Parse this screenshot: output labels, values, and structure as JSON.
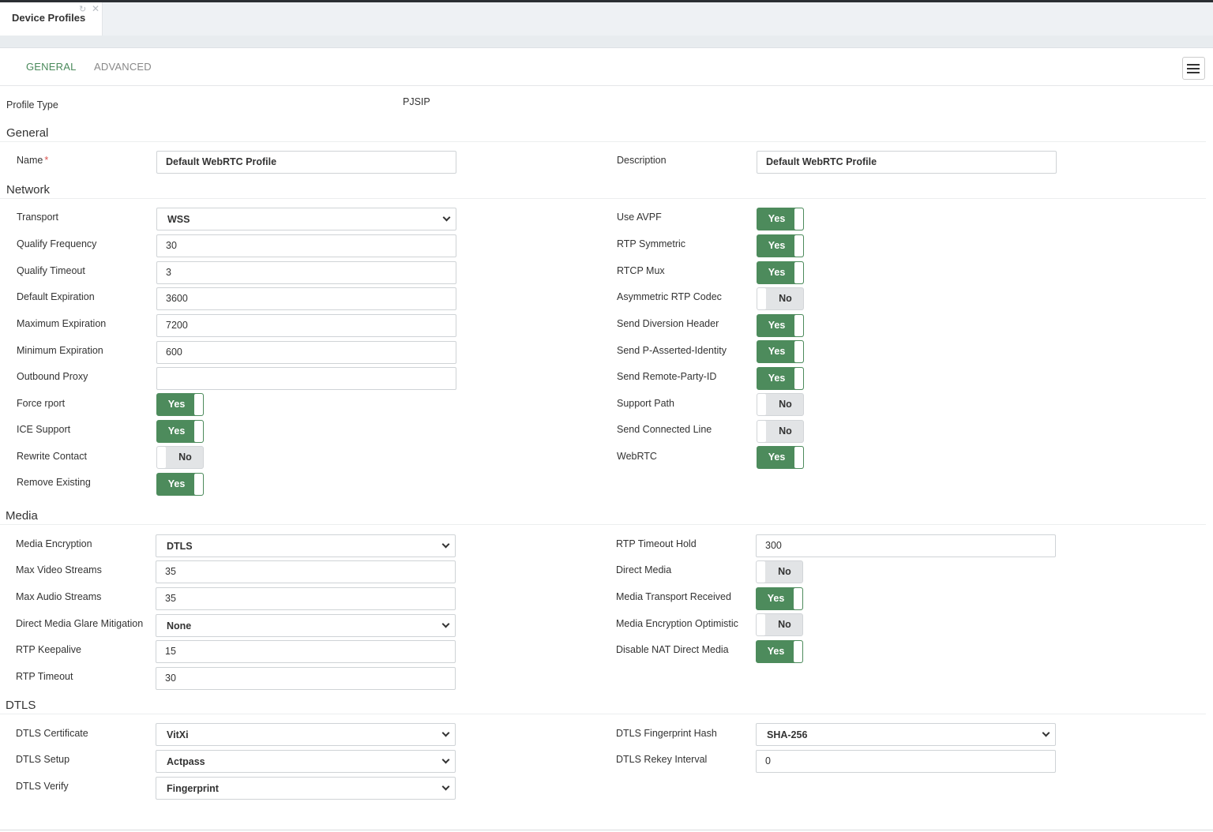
{
  "doc_tab": {
    "label": "Device Profiles"
  },
  "form_tabs": {
    "general": "GENERAL",
    "advanced": "ADVANCED"
  },
  "profile_type": {
    "label": "Profile Type",
    "value": "PJSIP"
  },
  "sections": {
    "general": "General",
    "network": "Network",
    "media": "Media",
    "dtls": "DTLS"
  },
  "general": {
    "name_label": "Name",
    "name_required": "*",
    "name_value": "Default WebRTC Profile",
    "description_label": "Description",
    "description_value": "Default WebRTC Profile"
  },
  "network": {
    "transport_label": "Transport",
    "transport_value": "WSS",
    "qualify_frequency_label": "Qualify Frequency",
    "qualify_frequency_value": "30",
    "qualify_timeout_label": "Qualify Timeout",
    "qualify_timeout_value": "3",
    "default_expiration_label": "Default Expiration",
    "default_expiration_value": "3600",
    "maximum_expiration_label": "Maximum Expiration",
    "maximum_expiration_value": "7200",
    "minimum_expiration_label": "Minimum Expiration",
    "minimum_expiration_value": "600",
    "outbound_proxy_label": "Outbound Proxy",
    "outbound_proxy_value": "",
    "force_rport_label": "Force rport",
    "force_rport_value": "Yes",
    "ice_support_label": "ICE Support",
    "ice_support_value": "Yes",
    "rewrite_contact_label": "Rewrite Contact",
    "rewrite_contact_value": "No",
    "remove_existing_label": "Remove Existing",
    "remove_existing_value": "Yes",
    "use_avpf_label": "Use AVPF",
    "use_avpf_value": "Yes",
    "rtp_symmetric_label": "RTP Symmetric",
    "rtp_symmetric_value": "Yes",
    "rtcp_mux_label": "RTCP Mux",
    "rtcp_mux_value": "Yes",
    "asymmetric_rtp_codec_label": "Asymmetric RTP Codec",
    "asymmetric_rtp_codec_value": "No",
    "send_diversion_header_label": "Send Diversion Header",
    "send_diversion_header_value": "Yes",
    "send_pai_label": "Send P-Asserted-Identity",
    "send_pai_value": "Yes",
    "send_rpid_label": "Send Remote-Party-ID",
    "send_rpid_value": "Yes",
    "support_path_label": "Support Path",
    "support_path_value": "No",
    "send_connected_line_label": "Send Connected Line",
    "send_connected_line_value": "No",
    "webrtc_label": "WebRTC",
    "webrtc_value": "Yes"
  },
  "media": {
    "media_encryption_label": "Media Encryption",
    "media_encryption_value": "DTLS",
    "max_video_streams_label": "Max Video Streams",
    "max_video_streams_value": "35",
    "max_audio_streams_label": "Max Audio Streams",
    "max_audio_streams_value": "35",
    "glare_label": "Direct Media Glare Mitigation",
    "glare_value": "None",
    "rtp_keepalive_label": "RTP Keepalive",
    "rtp_keepalive_value": "15",
    "rtp_timeout_label": "RTP Timeout",
    "rtp_timeout_value": "30",
    "rtp_timeout_hold_label": "RTP Timeout Hold",
    "rtp_timeout_hold_value": "300",
    "direct_media_label": "Direct Media",
    "direct_media_value": "No",
    "media_transport_received_label": "Media Transport Received",
    "media_transport_received_value": "Yes",
    "media_encryption_optimistic_label": "Media Encryption Optimistic",
    "media_encryption_optimistic_value": "No",
    "disable_nat_direct_media_label": "Disable NAT Direct Media",
    "disable_nat_direct_media_value": "Yes"
  },
  "dtls": {
    "certificate_label": "DTLS Certificate",
    "certificate_value": "VitXi",
    "setup_label": "DTLS Setup",
    "setup_value": "Actpass",
    "verify_label": "DTLS Verify",
    "verify_value": "Fingerprint",
    "fingerprint_hash_label": "DTLS Fingerprint Hash",
    "fingerprint_hash_value": "SHA-256",
    "rekey_interval_label": "DTLS Rekey Interval",
    "rekey_interval_value": "0"
  },
  "icons": {
    "refresh": "refresh-icon",
    "close": "close-icon",
    "list": "list-icon",
    "chevron": "chevron-down-icon"
  },
  "colors": {
    "accent": "#4d8b5c",
    "tab_active": "#4a8a5b",
    "required": "#d9534f"
  }
}
